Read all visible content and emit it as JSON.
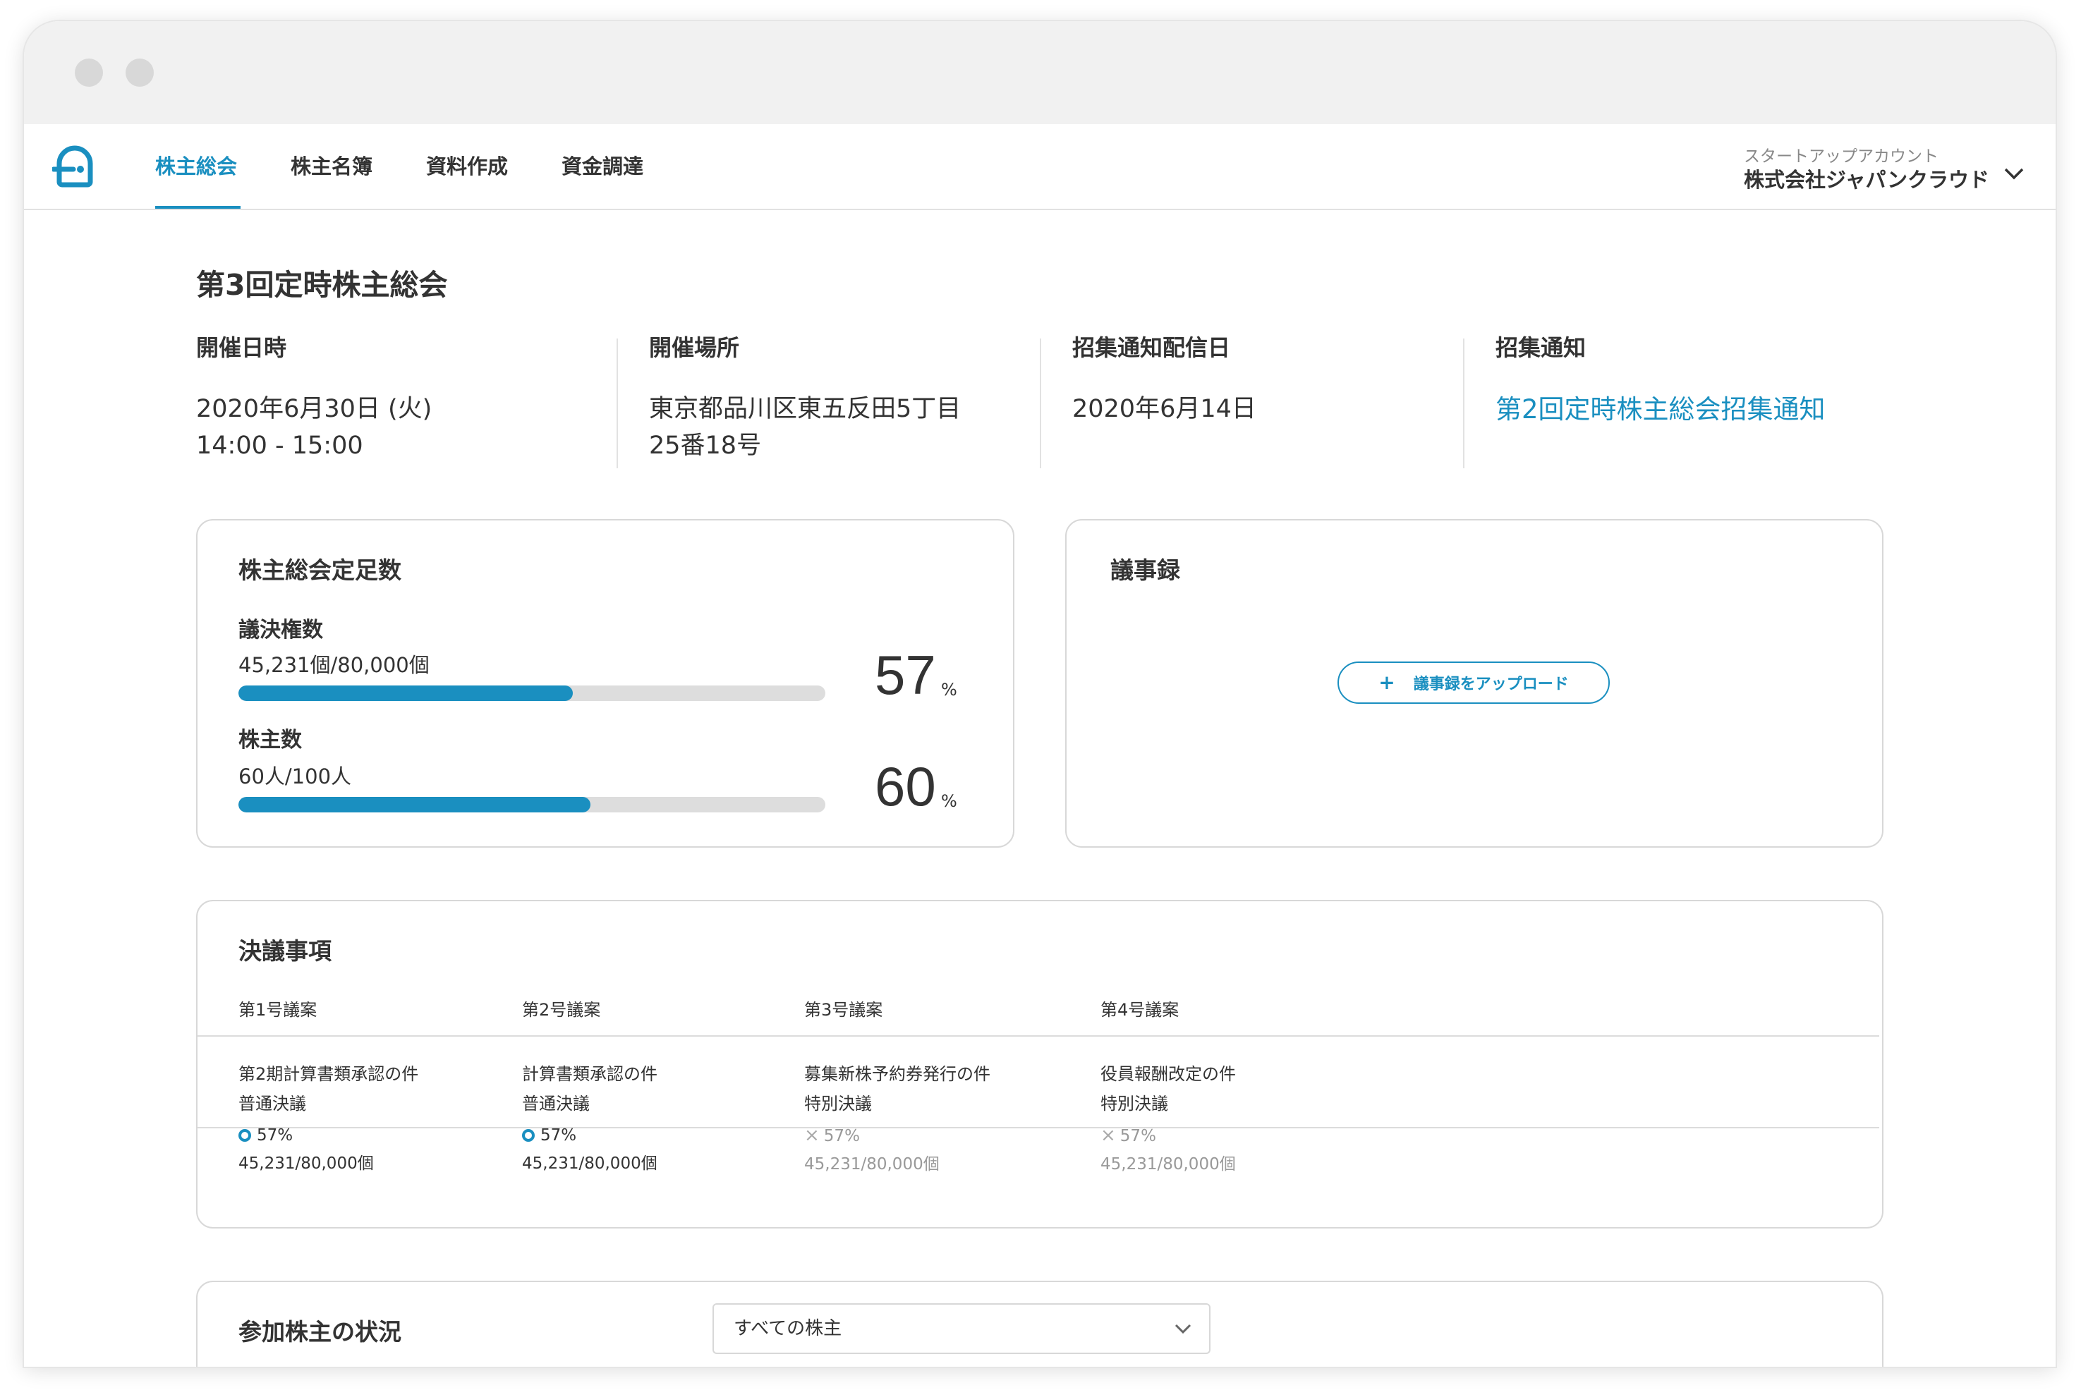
{
  "nav": {
    "tabs": [
      {
        "label": "株主総会",
        "active": true
      },
      {
        "label": "株主名簿",
        "active": false
      },
      {
        "label": "資料作成",
        "active": false
      },
      {
        "label": "資金調達",
        "active": false
      }
    ],
    "account_type": "スタートアップアカウント",
    "account_name": "株式会社ジャパンクラウド"
  },
  "meeting": {
    "title": "第3回定時株主総会",
    "date_label": "開催日時",
    "date_line1": "2020年6月30日 (火)",
    "date_line2": "14:00 - 15:00",
    "place_label": "開催場所",
    "place_line1": "東京都品川区東五反田5丁目",
    "place_line2": "25番18号",
    "notice_date_label": "招集通知配信日",
    "notice_date": "2020年6月14日",
    "notice_label": "招集通知",
    "notice_link": "第2回定時株主総会招集通知"
  },
  "quorum": {
    "title": "株主総会定足数",
    "items": [
      {
        "label": "議決権数",
        "count": "45,231個/80,000個",
        "percent": "57",
        "fill": 0.57
      },
      {
        "label": "株主数",
        "count": "60人/100人",
        "percent": "60",
        "fill": 0.6
      }
    ],
    "unit": "%"
  },
  "minutes": {
    "title": "議事録",
    "upload_label": "議事録をアップロード",
    "upload_icon": "plus-icon"
  },
  "resolutions": {
    "title": "決議事項",
    "items": [
      {
        "heading": "第1号議案",
        "name": "第2期計算書類承認の件",
        "type": "普通決議",
        "status": "approved",
        "percent": "57%",
        "count": "45,231/80,000個"
      },
      {
        "heading": "第2号議案",
        "name": "計算書類承認の件",
        "type": "普通決議",
        "status": "approved",
        "percent": "57%",
        "count": "45,231/80,000個"
      },
      {
        "heading": "第3号議案",
        "name": "募集新株予約券発行の件",
        "type": "特別決議",
        "status": "rejected",
        "percent": "57%",
        "count": "45,231/80,000個"
      },
      {
        "heading": "第4号議案",
        "name": "役員報酬改定の件",
        "type": "特別決議",
        "status": "rejected",
        "percent": "57%",
        "count": "45,231/80,000個"
      }
    ]
  },
  "participants": {
    "title": "参加株主の状況",
    "filter_selected": "すべての株主"
  },
  "colors": {
    "accent": "#1a8fc0",
    "text": "#333333",
    "muted": "#999999",
    "track": "#dddddd",
    "border": "#d8d8d8"
  }
}
